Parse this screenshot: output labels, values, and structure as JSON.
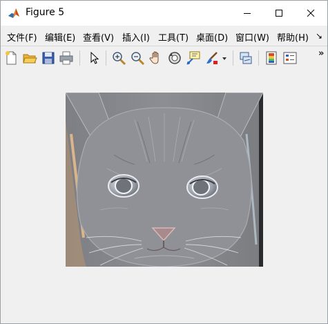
{
  "window": {
    "title": "Figure 5",
    "controls": [
      "minimize",
      "maximize",
      "close"
    ]
  },
  "menu": {
    "items": [
      {
        "label": "文件(F)"
      },
      {
        "label": "编辑(E)"
      },
      {
        "label": "查看(V)"
      },
      {
        "label": "插入(I)"
      },
      {
        "label": "工具(T)"
      },
      {
        "label": "桌面(D)"
      },
      {
        "label": "窗口(W)"
      },
      {
        "label": "帮助(H)"
      }
    ],
    "overflow": "↘"
  },
  "toolbar": {
    "tools": [
      "new-figure-icon",
      "open-file-icon",
      "save-icon",
      "print-icon",
      "edit-plot-arrow-icon",
      "zoom-in-icon",
      "zoom-out-icon",
      "pan-hand-icon",
      "rotate-3d-icon",
      "data-cursor-icon",
      "brush-icon",
      "link-plot-icon",
      "colorbar-icon",
      "legend-icon"
    ],
    "overflow": "»"
  },
  "figure": {
    "image": "embossed-cat-image"
  },
  "colors": {
    "titlebar": "#ffffff",
    "background": "#f0f0f0"
  }
}
